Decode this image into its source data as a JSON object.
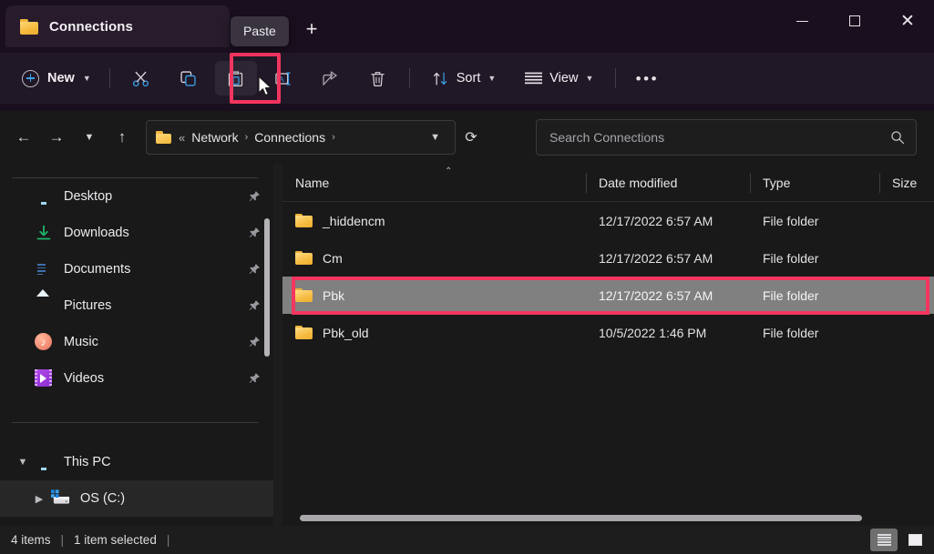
{
  "window": {
    "tab_title": "Connections",
    "tooltip": "Paste",
    "new_tab_label": "+",
    "controls": {
      "minimize": "Minimize",
      "maximize": "Maximize",
      "close": "Close"
    }
  },
  "toolbar": {
    "new_label": "New",
    "cut_label": "Cut",
    "copy_label": "Copy",
    "paste_label": "Paste",
    "rename_label": "Rename",
    "share_label": "Share",
    "delete_label": "Delete",
    "sort_label": "Sort",
    "view_label": "View",
    "more_label": "•••"
  },
  "address": {
    "back": "←",
    "forward": "→",
    "recent": "⌄",
    "up": "↑",
    "prefix": "«",
    "crumbs": [
      "Network",
      "Connections"
    ],
    "separator": "›",
    "refresh": "⟳"
  },
  "search": {
    "placeholder": "Search Connections",
    "value": ""
  },
  "sidebar": {
    "quick_items": [
      {
        "label": "Desktop",
        "icon": "desktop-icon",
        "pinned": true
      },
      {
        "label": "Downloads",
        "icon": "downloads-icon",
        "pinned": true
      },
      {
        "label": "Documents",
        "icon": "documents-icon",
        "pinned": true
      },
      {
        "label": "Pictures",
        "icon": "pictures-icon",
        "pinned": true
      },
      {
        "label": "Music",
        "icon": "music-icon",
        "pinned": true
      },
      {
        "label": "Videos",
        "icon": "videos-icon",
        "pinned": true
      }
    ],
    "this_pc": {
      "label": "This PC",
      "expanded": true
    },
    "drive": {
      "label": "OS (C:)",
      "expanded": false
    }
  },
  "columns": {
    "name": "Name",
    "date_modified": "Date modified",
    "type": "Type",
    "size": "Size",
    "sort_indicator": "⌃"
  },
  "files": [
    {
      "name": "_hiddencm",
      "date": "12/17/2022 6:57 AM",
      "type": "File folder",
      "size": "",
      "selected": false
    },
    {
      "name": "Cm",
      "date": "12/17/2022 6:57 AM",
      "type": "File folder",
      "size": "",
      "selected": false
    },
    {
      "name": "Pbk",
      "date": "12/17/2022 6:57 AM",
      "type": "File folder",
      "size": "",
      "selected": true
    },
    {
      "name": "Pbk_old",
      "date": "10/5/2022 1:46 PM",
      "type": "File folder",
      "size": "",
      "selected": false
    }
  ],
  "status": {
    "item_count": "4 items",
    "selection": "1 item selected",
    "sep": "|"
  },
  "colors": {
    "highlight": "#f4355f",
    "selection": "#808080",
    "accent": "#3aa0e8",
    "folder": "#f5bc42"
  }
}
